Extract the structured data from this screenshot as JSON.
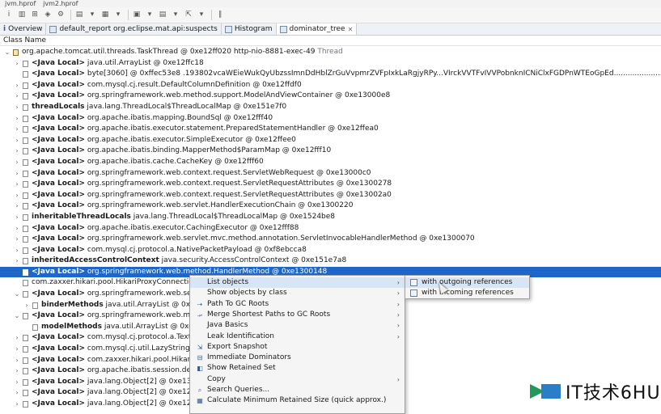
{
  "title_tabs": [
    "jvm.hprof",
    "jvm2.hprof"
  ],
  "editor_tabs": [
    {
      "label": "Overview",
      "active": false
    },
    {
      "label": "default_report  org.eclipse.mat.api:suspects",
      "active": false
    },
    {
      "label": "Histogram",
      "active": false
    },
    {
      "label": "dominator_tree",
      "active": true
    }
  ],
  "column_header": "Class Name",
  "tree_rows": [
    {
      "expand": "open",
      "indent": 0,
      "icon": "thread",
      "label": "",
      "text": "org.apache.tomcat.util.threads.TaskThread @ 0xe12ff020  http-nio-8881-exec-49",
      "suffix": "Thread"
    },
    {
      "expand": "closed",
      "indent": 1,
      "icon": "file",
      "label": "<Java Local>",
      "text": "java.util.ArrayList @ 0xe12ffc18",
      "suffix": ""
    },
    {
      "expand": "",
      "indent": 1,
      "icon": "file",
      "label": "<Java Local>",
      "text": "byte[3060] @ 0xffec53e8  .193802vcaWEieWukQyUbzssImnDdHblZrGuVvpmrZVFpIxkLaRgjyRPy...VIrckVVTFvIVVPobnknICNiClxFGDPnWTEoGpEd..........................................................",
      "suffix": ""
    },
    {
      "expand": "closed",
      "indent": 1,
      "icon": "file",
      "label": "<Java Local>",
      "text": "com.mysql.cj.result.DefaultColumnDefinition @ 0xe12ffdf0",
      "suffix": ""
    },
    {
      "expand": "closed",
      "indent": 1,
      "icon": "file",
      "label": "<Java Local>",
      "text": "org.springframework.web.method.support.ModelAndViewContainer @ 0xe13000e8",
      "suffix": ""
    },
    {
      "expand": "closed",
      "indent": 1,
      "icon": "file",
      "label": "threadLocals",
      "text": "java.lang.ThreadLocal$ThreadLocalMap @ 0xe151e7f0",
      "suffix": ""
    },
    {
      "expand": "closed",
      "indent": 1,
      "icon": "file",
      "label": "<Java Local>",
      "text": "org.apache.ibatis.mapping.BoundSql @ 0xe12fff40",
      "suffix": ""
    },
    {
      "expand": "closed",
      "indent": 1,
      "icon": "file",
      "label": "<Java Local>",
      "text": "org.apache.ibatis.executor.statement.PreparedStatementHandler @ 0xe12ffea0",
      "suffix": ""
    },
    {
      "expand": "closed",
      "indent": 1,
      "icon": "file",
      "label": "<Java Local>",
      "text": "org.apache.ibatis.executor.SimpleExecutor @ 0xe12ffee0",
      "suffix": ""
    },
    {
      "expand": "closed",
      "indent": 1,
      "icon": "file",
      "label": "<Java Local>",
      "text": "org.apache.ibatis.binding.MapperMethod$ParamMap @ 0xe12fff10",
      "suffix": ""
    },
    {
      "expand": "closed",
      "indent": 1,
      "icon": "file",
      "label": "<Java Local>",
      "text": "org.apache.ibatis.cache.CacheKey @ 0xe12fff60",
      "suffix": ""
    },
    {
      "expand": "closed",
      "indent": 1,
      "icon": "file",
      "label": "<Java Local>",
      "text": "org.springframework.web.context.request.ServletWebRequest @ 0xe13000c0",
      "suffix": ""
    },
    {
      "expand": "closed",
      "indent": 1,
      "icon": "file",
      "label": "<Java Local>",
      "text": "org.springframework.web.context.request.ServletRequestAttributes @ 0xe1300278",
      "suffix": ""
    },
    {
      "expand": "closed",
      "indent": 1,
      "icon": "file",
      "label": "<Java Local>",
      "text": "org.springframework.web.context.request.ServletRequestAttributes @ 0xe13002a0",
      "suffix": ""
    },
    {
      "expand": "closed",
      "indent": 1,
      "icon": "file",
      "label": "<Java Local>",
      "text": "org.springframework.web.servlet.HandlerExecutionChain @ 0xe1300220",
      "suffix": ""
    },
    {
      "expand": "closed",
      "indent": 1,
      "icon": "file",
      "label": "inheritableThreadLocals",
      "text": "java.lang.ThreadLocal$ThreadLocalMap @ 0xe1524be8",
      "suffix": ""
    },
    {
      "expand": "closed",
      "indent": 1,
      "icon": "file",
      "label": "<Java Local>",
      "text": "org.apache.ibatis.executor.CachingExecutor @ 0xe12fff88",
      "suffix": ""
    },
    {
      "expand": "closed",
      "indent": 1,
      "icon": "file",
      "label": "<Java Local>",
      "text": "org.springframework.web.servlet.mvc.method.annotation.ServletInvocableHandlerMethod @ 0xe1300070",
      "suffix": ""
    },
    {
      "expand": "closed",
      "indent": 1,
      "icon": "file",
      "label": "<Java Local>",
      "text": "com.mysql.cj.protocol.a.NativePacketPayload @ 0xf8ebcca8",
      "suffix": ""
    },
    {
      "expand": "closed",
      "indent": 1,
      "icon": "file",
      "label": "inheritedAccessControlContext",
      "text": "java.security.AccessControlContext @ 0xe151e7a8",
      "suffix": ""
    },
    {
      "expand": "",
      "indent": 1,
      "icon": "file",
      "label": "<Java Local>",
      "text": "org.springframework.web.method.HandlerMethod @ 0xe1300148",
      "suffix": "",
      "selected": true
    },
    {
      "expand": "",
      "indent": 1,
      "icon": "file",
      "label": "",
      "text": "com.zaxxer.hikari.pool.HikariProxyConnection",
      "suffix": ""
    },
    {
      "expand": "open",
      "indent": 1,
      "icon": "file",
      "label": "<Java Local>",
      "text": "org.springframework.web.servl",
      "suffix": ""
    },
    {
      "expand": "closed",
      "indent": 2,
      "icon": "file",
      "label": "binderMethods",
      "text": "java.util.ArrayList @ 0xe13",
      "suffix": ""
    },
    {
      "expand": "open",
      "indent": 1,
      "icon": "file",
      "label": "<Java Local>",
      "text": "org.springframework.web.meth",
      "suffix": ""
    },
    {
      "expand": "",
      "indent": 2,
      "icon": "file",
      "label": "modelMethods",
      "text": "java.util.ArrayList @ 0xe13",
      "suffix": ""
    },
    {
      "expand": "closed",
      "indent": 1,
      "icon": "file",
      "label": "<Java Local>",
      "text": "com.mysql.cj.protocol.a.TextRo",
      "suffix": ""
    },
    {
      "expand": "closed",
      "indent": 1,
      "icon": "file",
      "label": "<Java Local>",
      "text": "com.mysql.cj.util.LazyString @ 0",
      "suffix": ""
    },
    {
      "expand": "closed",
      "indent": 1,
      "icon": "file",
      "label": "<Java Local>",
      "text": "com.zaxxer.hikari.pool.HikariPro",
      "suffix": ""
    },
    {
      "expand": "closed",
      "indent": 1,
      "icon": "file",
      "label": "<Java Local>",
      "text": "org.apache.ibatis.session.defau",
      "suffix": ""
    },
    {
      "expand": "closed",
      "indent": 1,
      "icon": "file",
      "label": "<Java Local>",
      "text": "java.lang.Object[2] @ 0xe1300",
      "suffix": ""
    },
    {
      "expand": "closed",
      "indent": 1,
      "icon": "file",
      "label": "<Java Local>",
      "text": "java.lang.Object[2] @ 0xe12ffc",
      "suffix": ""
    },
    {
      "expand": "closed",
      "indent": 1,
      "icon": "file",
      "label": "<Java Local>",
      "text": "java.lang.Object[2] @ 0xe12ffd",
      "suffix": ""
    }
  ],
  "context_menu": [
    {
      "label": "List objects",
      "icon": "",
      "submenu": true,
      "highlight": true
    },
    {
      "label": "Show objects by class",
      "icon": "",
      "submenu": true
    },
    {
      "label": "Path To GC Roots",
      "icon": "path-icon",
      "submenu": true
    },
    {
      "label": "Merge Shortest Paths to GC Roots",
      "icon": "merge-icon",
      "submenu": true
    },
    {
      "label": "Java Basics",
      "icon": "",
      "submenu": true
    },
    {
      "label": "Leak Identification",
      "icon": "",
      "submenu": true
    },
    {
      "label": "Export Snapshot",
      "icon": "export-icon",
      "submenu": false
    },
    {
      "label": "Immediate Dominators",
      "icon": "dominator-icon",
      "submenu": false
    },
    {
      "label": "Show Retained Set",
      "icon": "retained-icon",
      "submenu": false
    },
    {
      "label": "Copy",
      "icon": "",
      "submenu": true
    },
    {
      "label": "Search Queries...",
      "icon": "search-icon",
      "submenu": false
    },
    {
      "label": "Calculate Minimum Retained Size (quick approx.)",
      "icon": "calc-icon",
      "submenu": false
    }
  ],
  "submenu": [
    {
      "label": "with outgoing references",
      "highlight": true
    },
    {
      "label": "with incoming references",
      "highlight": false
    }
  ],
  "watermark": "IT技术6HU",
  "colors": {
    "selection": "#1e67c8",
    "menu_highlight": "#d7e6f7",
    "tab_bg": "#eef1f5"
  }
}
